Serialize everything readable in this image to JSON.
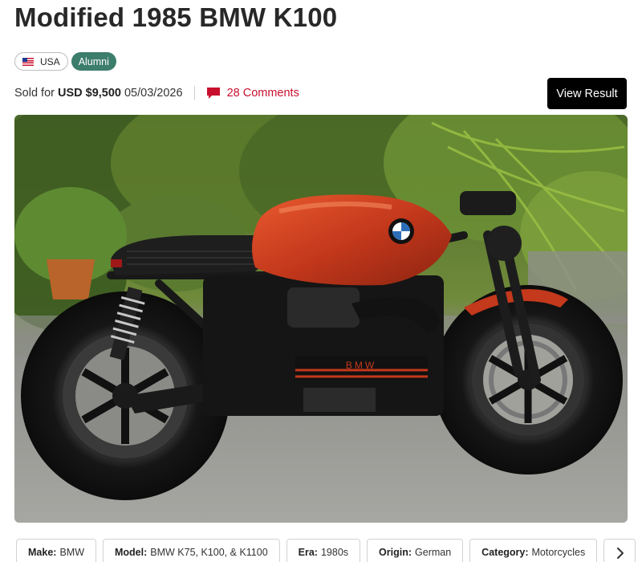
{
  "listing": {
    "title": "Modified 1985 BMW K100",
    "country_badge": "USA",
    "status_badge": "Alumni",
    "sold_label": "Sold for",
    "sold_price": "USD $9,500",
    "sold_date": "05/03/2026",
    "comments_label": "28 Comments",
    "view_result_label": "View Result"
  },
  "hero_image": {
    "alt": "Modified 1985 BMW K100",
    "tank_lettering": "BMW"
  },
  "facts": [
    {
      "key": "Make:",
      "value": "BMW"
    },
    {
      "key": "Model:",
      "value": "BMW K75, K100, & K1100"
    },
    {
      "key": "Era:",
      "value": "1980s"
    },
    {
      "key": "Origin:",
      "value": "German"
    },
    {
      "key": "Category:",
      "value": "Motorcycles"
    }
  ],
  "colors": {
    "accent_red": "#c8102e",
    "alumni_green": "#3c7d6b",
    "button_black": "#000000",
    "tank_orange": "#c4381c"
  },
  "icons": {
    "flag": "us-flag-icon",
    "comments": "comment-icon",
    "next": "chevron-right-icon"
  }
}
